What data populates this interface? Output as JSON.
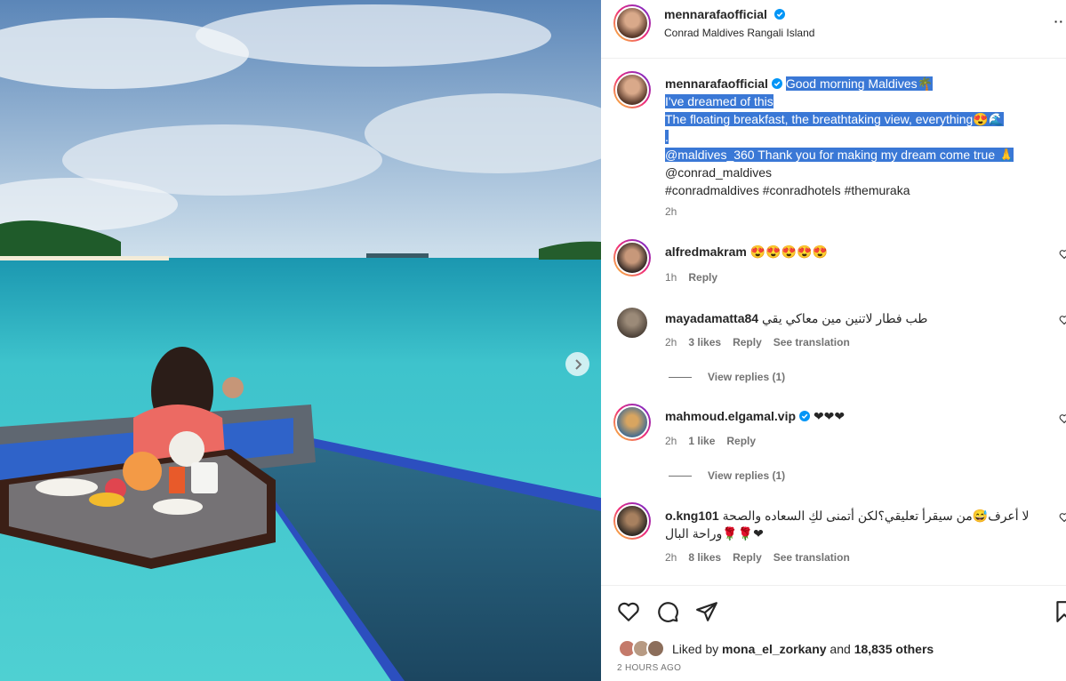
{
  "post": {
    "author": "mennarafaofficial",
    "location": "Conrad Maldives Rangali Island"
  },
  "caption": {
    "author": "mennarafaofficial",
    "lines": [
      "Good morning Maldives🌴",
      "I've dreamed of this",
      "The floating breakfast, the breathtaking view, everything😍🌊",
      ".",
      "@maldives_360 Thank you for making my dream come true 🙏",
      "@conrad_maldives",
      "#conradmaldives #conradhotels #themuraka"
    ],
    "time": "2h"
  },
  "comments": [
    {
      "user": "alfredmakram",
      "verified": false,
      "text": "😍😍😍😍😍",
      "time": "1h",
      "likes": "",
      "reply": "Reply",
      "translate": "",
      "view_replies": ""
    },
    {
      "user": "mayadamatta84",
      "verified": false,
      "text": "طب فطار لاتنين مين معاكي يقي",
      "time": "2h",
      "likes": "3 likes",
      "reply": "Reply",
      "translate": "See translation",
      "view_replies": "View replies (1)"
    },
    {
      "user": "mahmoud.elgamal.vip",
      "verified": true,
      "text": "❤❤❤",
      "time": "2h",
      "likes": "1 like",
      "reply": "Reply",
      "translate": "",
      "view_replies": "View replies (1)"
    },
    {
      "user": "o.kng101",
      "verified": false,
      "text": "لا أعرف😅من سيقرأ تعليقي؟لكن أتمنى لكِ السعاده والصحة 🌹🌹وراحة البال❤",
      "time": "2h",
      "likes": "8 likes",
      "reply": "Reply",
      "translate": "See translation",
      "view_replies": ""
    }
  ],
  "footer": {
    "liked_by_prefix": "Liked by ",
    "liked_by_user": "mona_el_zorkany",
    "liked_by_suffix": " and ",
    "others": "18,835 others",
    "time_ago": "2 HOURS AGO"
  },
  "colors": {
    "selection": "#3a78d6",
    "verified": "#0095f6",
    "muted": "#737373",
    "text": "#262626"
  },
  "icons": [
    "verified-badge-icon",
    "next-arrow-icon",
    "heart-icon",
    "comment-icon",
    "share-icon",
    "bookmark-icon",
    "more-icon"
  ]
}
